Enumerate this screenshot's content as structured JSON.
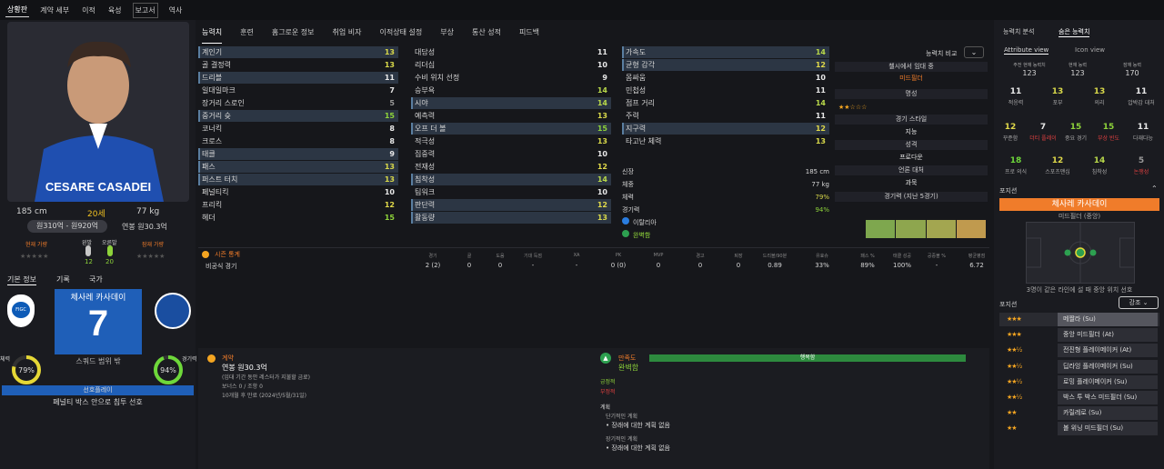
{
  "topnav": [
    "상황판",
    "계약 세부",
    "이적",
    "육성",
    "보고서",
    "역사"
  ],
  "player": {
    "name_jersey": "CESARE CASADEI",
    "height": "185 cm",
    "age": "20세",
    "weight": "77 kg",
    "value": "원310억 - 원920억",
    "wage": "연봉 원30.3억",
    "current_ability": "현재 가량",
    "potential": "잠재 가량",
    "left_foot": "왼발",
    "right_foot": "오른발",
    "left_foot_val": "12",
    "right_foot_val": "20",
    "korean_name": "체사레 카사데이",
    "number": "7",
    "squad_status": "스쿼드 범위 밖",
    "form_pct": "79%",
    "fitness_pct": "94%",
    "form_label": "체력",
    "fitness_label": "경기력",
    "pref_title": "선호플레이",
    "pref_text": "페널티 박스 안으로 침투 선호"
  },
  "left_tabs": [
    "기본 정보",
    "기록",
    "국가"
  ],
  "tabs": [
    "능력치",
    "훈련",
    "홈그로운 정보",
    "취업 비자",
    "이적상태 설정",
    "부상",
    "통산 성적",
    "피드백"
  ],
  "attrs_col1": [
    {
      "n": "계인기",
      "v": 13,
      "hl": true
    },
    {
      "n": "골 결정력",
      "v": 13
    },
    {
      "n": "드리블",
      "v": 11,
      "hl": true
    },
    {
      "n": "일대일마크",
      "v": 7
    },
    {
      "n": "장거리 스로인",
      "v": 5
    },
    {
      "n": "중거리 슛",
      "v": 15,
      "hl": true
    },
    {
      "n": "코너킥",
      "v": 8
    },
    {
      "n": "크로스",
      "v": 8
    },
    {
      "n": "태클",
      "v": 9,
      "hl": true
    },
    {
      "n": "패스",
      "v": 13,
      "hl": true
    },
    {
      "n": "퍼스트 터치",
      "v": 13,
      "hl": true
    },
    {
      "n": "페널티킥",
      "v": 10
    },
    {
      "n": "프리킥",
      "v": 12
    },
    {
      "n": "헤더",
      "v": 15
    }
  ],
  "attrs_col2": [
    {
      "n": "대담성",
      "v": 11
    },
    {
      "n": "리더십",
      "v": 10
    },
    {
      "n": "수비 위치 선정",
      "v": 9
    },
    {
      "n": "승부욕",
      "v": 14
    },
    {
      "n": "시야",
      "v": 14,
      "hl": true
    },
    {
      "n": "예측력",
      "v": 13
    },
    {
      "n": "오프 더 볼",
      "v": 15,
      "hl": true
    },
    {
      "n": "적극성",
      "v": 13
    },
    {
      "n": "집중력",
      "v": 10
    },
    {
      "n": "전재성",
      "v": 12
    },
    {
      "n": "침착성",
      "v": 14,
      "hl": true
    },
    {
      "n": "팀워크",
      "v": 10
    },
    {
      "n": "판단력",
      "v": 12,
      "hl": true
    },
    {
      "n": "활동량",
      "v": 13,
      "hl": true
    }
  ],
  "attrs_col3": [
    {
      "n": "가속도",
      "v": 14,
      "hl": true
    },
    {
      "n": "균형 감각",
      "v": 12,
      "hl": true
    },
    {
      "n": "몸싸움",
      "v": 10
    },
    {
      "n": "민첩성",
      "v": 11
    },
    {
      "n": "점프 거리",
      "v": 14
    },
    {
      "n": "주력",
      "v": 11
    },
    {
      "n": "지구력",
      "v": 12,
      "hl": true
    },
    {
      "n": "타고난 체력",
      "v": 13
    }
  ],
  "physical": {
    "height_l": "신장",
    "height_v": "185 cm",
    "weight_l": "체중",
    "weight_v": "77 kg",
    "cond_l": "체력",
    "cond_v": "79%",
    "match_l": "경기력",
    "match_v": "94%",
    "nation": "이탈리아",
    "status": "완벽함"
  },
  "compare": "능력치 비교",
  "info": {
    "pos_h": "첼시에서 임대 중",
    "pos_v": "미드필더",
    "rep_h": "명성",
    "style_h": "경기 스타일",
    "style_v": "지능",
    "pers_h": "성격",
    "pers_v": "프로다운",
    "media_h": "언론 대처",
    "media_v": "과묵",
    "form_h": "경기력 (지난 5경기)"
  },
  "stats": {
    "title": "시즌 통계",
    "headers": [
      "경기",
      "골",
      "도움",
      "기대 득점",
      "XA",
      "PK",
      "MVP",
      "경고",
      "퇴장",
      "드리블/90분",
      "유효슈",
      "패스 %",
      "태클 성공",
      "공중볼 %",
      "평균평점"
    ],
    "row_label": "비공식 경기",
    "row": [
      "2 (2)",
      "0",
      "0",
      "-",
      "-",
      "0 (0)",
      "0",
      "0",
      "0",
      "0.89",
      "33%",
      "89%",
      "100%",
      "-",
      "6.72"
    ]
  },
  "contract": {
    "title": "계약",
    "wage": "연봉 원30.3억",
    "note": "(임대 기간 동안 레스터가 지불할 금료)",
    "bonus": "보너스 0 / 조항 0",
    "expiry": "10개월 후 만료 (2024년/5월/31일)"
  },
  "happy": {
    "title": "만족도",
    "status": "완벽함",
    "bar": "행복함",
    "pos": "긍정적",
    "neg": "부정적",
    "plans": "계획",
    "short": "단기적인 계획",
    "short_item": "장래에 대한 계획 없음",
    "long": "장기적인 계획",
    "long_item": "장래에 대한 계획 없음"
  },
  "right": {
    "tabs": [
      "능력치 분석",
      "숨은 능력치"
    ],
    "views": [
      "Attribute view",
      "Icon view"
    ],
    "ca_l": "주전 현재 능력치",
    "ca_v": "123",
    "pa_l": "현재 능력",
    "pa_v": "123",
    "pot_l": "잠재 능력",
    "pot_v": "170",
    "grid1": [
      {
        "n": "11",
        "l": "적응력"
      },
      {
        "n": "13",
        "l": "포부"
      },
      {
        "n": "13",
        "l": "의리"
      },
      {
        "n": "11",
        "l": "압박감 대처"
      }
    ],
    "grid2": [
      {
        "n": "12",
        "l": "꾸준함"
      },
      {
        "n": "7",
        "l": "더티 플레이"
      },
      {
        "n": "15",
        "l": "중요 경기"
      },
      {
        "n": "15",
        "l": "부상 빈도"
      },
      {
        "n": "11",
        "l": "다재다능"
      }
    ],
    "grid3": [
      {
        "n": "18",
        "l": "프로 의식"
      },
      {
        "n": "12",
        "l": "스포츠맨십"
      },
      {
        "n": "14",
        "l": "침착성"
      },
      {
        "n": "5",
        "l": "논쟁성"
      }
    ],
    "pos_title": "포지션",
    "pos_name": "체사레 카사데이",
    "pos_sub": "미드필더 (중앙)",
    "pos_note": "3명이 같은 라인에 설 때 중앙 위치 선호",
    "roles_title": "포지션",
    "roles_btn": "강조",
    "roles": [
      "메짤라 (Su)",
      "중앙 미드필더 (At)",
      "전진형 플레이메이커 (At)",
      "딥라잉 플레이메이커 (Su)",
      "로밍 플레이메이커 (Su)",
      "박스 투 박스 미드필더 (Su)",
      "카릴레로 (Su)",
      "볼 위닝 미드필더 (Su)"
    ]
  }
}
